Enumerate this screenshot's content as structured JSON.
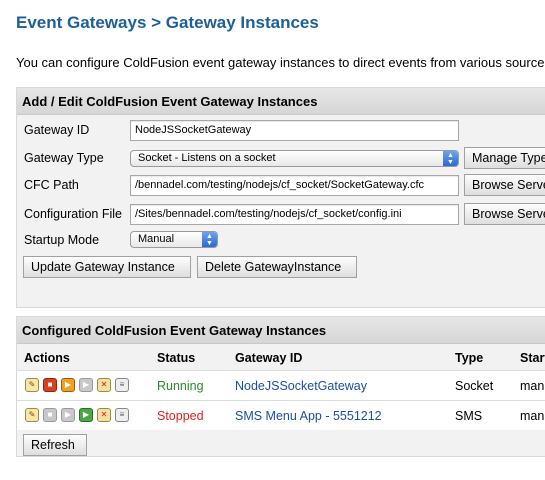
{
  "page": {
    "title": "Event Gateways > Gateway Instances",
    "intro": "You can configure ColdFusion event gateway instances to direct events from various source"
  },
  "form": {
    "header": "Add / Edit ColdFusion Event Gateway Instances",
    "gateway_id": {
      "label": "Gateway ID",
      "value": "NodeJSSocketGateway"
    },
    "gateway_type": {
      "label": "Gateway Type",
      "value": "Socket - Listens on a socket",
      "button": "Manage Types"
    },
    "cfc_path": {
      "label": "CFC Path",
      "value": "/bennadel.com/testing/nodejs/cf_socket/SocketGateway.cfc",
      "button": "Browse Server"
    },
    "config_file": {
      "label": "Configuration File",
      "value": "/Sites/bennadel.com/testing/nodejs/cf_socket/config.ini",
      "button": "Browse Server"
    },
    "startup_mode": {
      "label": "Startup Mode",
      "value": "Manual"
    },
    "update_button": "Update Gateway Instance",
    "delete_button": "Delete GatewayInstance"
  },
  "instances": {
    "header": "Configured ColdFusion Event Gateway Instances",
    "columns": [
      "Actions",
      "Status",
      "Gateway ID",
      "Type",
      "Startup"
    ],
    "rows": [
      {
        "status": "Running",
        "gateway_id": "NodeJSSocketGateway",
        "type": "Socket",
        "startup": "manual"
      },
      {
        "status": "Stopped",
        "gateway_id": "SMS Menu App - 5551212",
        "type": "SMS",
        "startup": "manual"
      }
    ],
    "refresh_button": "Refresh"
  },
  "colors": {
    "title": "#1d5f9a",
    "running": "#2a8a2a",
    "stopped": "#e02020",
    "link": "#1a4fa0"
  },
  "icons": {
    "row_actions": [
      "edit-icon",
      "stop-icon",
      "restart-icon",
      "start-icon",
      "delete-icon",
      "log-icon"
    ]
  }
}
